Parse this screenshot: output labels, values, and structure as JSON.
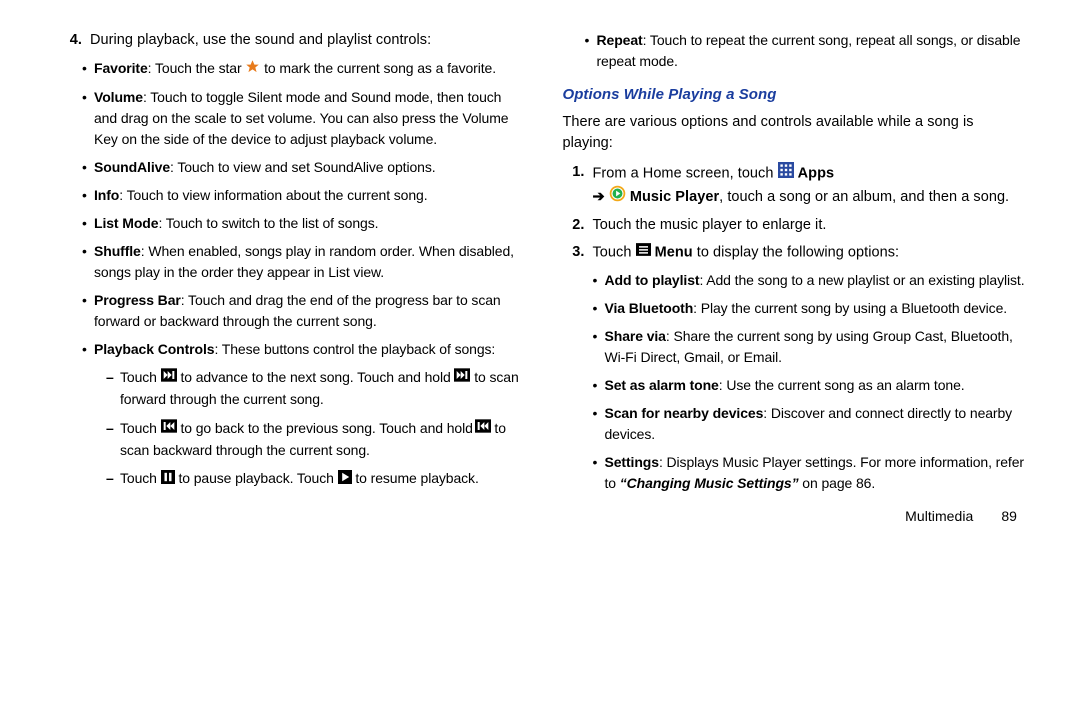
{
  "left": {
    "item4": "During playback, use the sound and playlist controls:",
    "favorite": {
      "label": "Favorite",
      "t1": ": Touch the star ",
      "t2": " to mark the current song as a favorite."
    },
    "volume": {
      "label": "Volume",
      "text": ": Touch to toggle Silent mode and Sound mode, then touch and drag on the scale to set volume. You can also press the Volume Key on the side of the device to adjust playback volume."
    },
    "soundalive": {
      "label": "SoundAlive",
      "text": ": Touch to view and set SoundAlive options."
    },
    "info": {
      "label": "Info",
      "text": ": Touch to view information about the current song."
    },
    "listmode": {
      "label": "List Mode",
      "text": ": Touch to switch to the list of songs."
    },
    "shuffle": {
      "label": "Shuffle",
      "text": ": When enabled, songs play in random order. When disabled, songs play in the order they appear in List view."
    },
    "progress": {
      "label": "Progress Bar",
      "text": ": Touch and drag the end of the progress bar to scan forward or backward through the current song."
    },
    "playback": {
      "label": "Playback Controls",
      "text": ": These buttons control the playback of songs:"
    },
    "d1": {
      "t1": "Touch ",
      "t2": " to advance to the next song. Touch and hold ",
      "t3": " to scan forward through the current song."
    },
    "d2": {
      "t1": "Touch ",
      "t2": " to go back to the previous song. Touch and hold ",
      "t3": " to scan backward through the current song."
    },
    "d3": {
      "t1": "Touch ",
      "t2": " to pause playback. Touch ",
      "t3": " to resume playback."
    }
  },
  "right": {
    "repeat": {
      "label": "Repeat",
      "text": ": Touch to repeat the current song, repeat all songs, or disable repeat mode."
    },
    "heading": "Options While Playing a Song",
    "intro": "There are various options and controls available while a song is playing:",
    "n1": {
      "t1": "From a Home screen, touch ",
      "apps": "Apps",
      "t2": "Music Player",
      "t3": ", touch a song or an album, and then a song."
    },
    "n2": "Touch the music player to enlarge it.",
    "n3": {
      "t1": "Touch ",
      "menu": "Menu",
      "t2": " to display the following options:"
    },
    "b1": {
      "label": "Add to playlist",
      "text": ": Add the song to a new playlist or an existing playlist."
    },
    "b2": {
      "label": "Via Bluetooth",
      "text": ": Play the current song by using a Bluetooth device."
    },
    "b3": {
      "label": "Share via",
      "text": ": Share the current song by using Group Cast, Bluetooth, Wi-Fi Direct, Gmail, or Email."
    },
    "b4": {
      "label": "Set as alarm tone",
      "text": ": Use the current song as an alarm tone."
    },
    "b5": {
      "label": "Scan for nearby devices",
      "text": ": Discover and connect directly to nearby devices."
    },
    "b6": {
      "label": "Settings",
      "t1": ": Displays Music Player settings. For more information, refer to ",
      "ref": "“Changing Music Settings”",
      "t2": "  on page 86."
    }
  },
  "footer": {
    "section": "Multimedia",
    "page": "89"
  }
}
